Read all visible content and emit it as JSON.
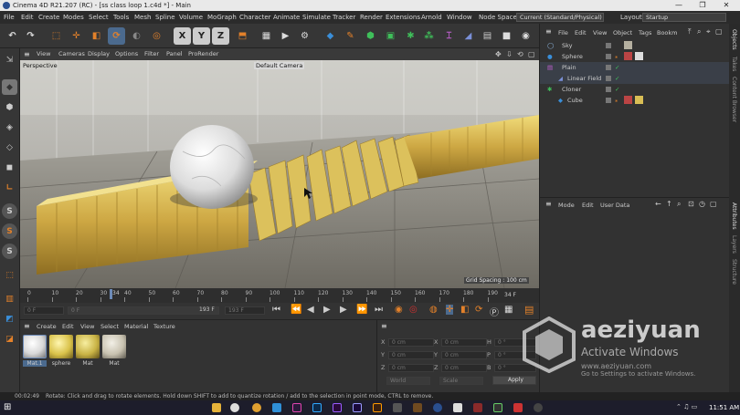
{
  "window": {
    "title": "Cinema 4D R21.207 (RC) - [ss class loop 1.c4d *] - Main",
    "minimize": "—",
    "maximize": "❐",
    "close": "✕"
  },
  "menubar": {
    "items": [
      "File",
      "Edit",
      "Create",
      "Modes",
      "Select",
      "Tools",
      "Mesh",
      "Spline",
      "Volume",
      "MoGraph",
      "Character",
      "Animate",
      "Simulate",
      "Tracker",
      "Render",
      "Extensions",
      "Arnold",
      "Window"
    ],
    "node_space_label": "Node Space:",
    "node_space_value": "Current (Standard/Physical)",
    "layout_label": "Layout:",
    "layout_value": "Startup"
  },
  "toolbar": {
    "axis_x": "X",
    "axis_y": "Y",
    "axis_z": "Z"
  },
  "left_tools": {
    "s1": "S",
    "s2": "S",
    "s3": "S"
  },
  "viewport": {
    "menu": [
      "View",
      "Cameras",
      "Display",
      "Options",
      "Filter",
      "Panel",
      "ProRender"
    ],
    "mode_label": "Perspective",
    "camera_label": "Default Camera",
    "grid_spacing": "Grid Spacing : 100 cm"
  },
  "timeline": {
    "ticks": [
      "0",
      "10",
      "20",
      "30",
      "40",
      "50",
      "60",
      "70",
      "80",
      "90",
      "100",
      "110",
      "120",
      "130",
      "140",
      "150",
      "160",
      "170",
      "180",
      "190"
    ],
    "current_frame": "34",
    "end_frame": "34 F"
  },
  "transport": {
    "start_field": "0 F",
    "current_field": "0 F",
    "max_field": "193 F",
    "end_field": "193 F"
  },
  "material_manager": {
    "menu": [
      "Create",
      "Edit",
      "View",
      "Select",
      "Material",
      "Texture"
    ],
    "materials": [
      {
        "name": "Mat.1",
        "color": "#d8d8d8"
      },
      {
        "name": "sphere",
        "color": "#d9c24a"
      },
      {
        "name": "Mat",
        "color": "#c9b345"
      },
      {
        "name": "Mat",
        "color": "#c8c2b0"
      }
    ]
  },
  "coordinates": {
    "x_label": "X",
    "y_label": "Y",
    "z_label": "Z",
    "x_val": "0 cm",
    "y_val": "0 cm",
    "z_val": "0 cm",
    "sx_val": "0 cm",
    "sy_val": "0 cm",
    "sz_val": "0 cm",
    "h_label": "H",
    "p_label": "P",
    "b_label": "B",
    "h_val": "0 °",
    "p_val": "0 °",
    "b_val": "0 °",
    "world_select": "World",
    "scale_select": "Scale",
    "apply_label": "Apply"
  },
  "object_manager": {
    "menu": [
      "File",
      "Edit",
      "View",
      "Object",
      "Tags",
      "Bookm"
    ],
    "objects": [
      {
        "name": "Sky",
        "indent": 0
      },
      {
        "name": "Sphere",
        "indent": 0
      },
      {
        "name": "Plain",
        "indent": 0
      },
      {
        "name": "Linear Field",
        "indent": 1
      },
      {
        "name": "Cloner",
        "indent": 0
      },
      {
        "name": "Cube",
        "indent": 1
      }
    ]
  },
  "attribute_manager": {
    "menu": [
      "Mode",
      "Edit",
      "User Data"
    ]
  },
  "side_tabs": [
    "Objects",
    "Takes",
    "Content Browser",
    "Attributes",
    "Layers",
    "Structure"
  ],
  "status": {
    "time": "00:02:49",
    "message": "Rotate: Click and drag to rotate elements. Hold down SHIFT to add to quantize rotation / add to the selection in point mode, CTRL to remove."
  },
  "watermark": {
    "brand": "aeziyuan",
    "sub": "www.aeziyuan.com",
    "activate_title": "Activate Windows",
    "activate_sub": "Go to Settings to activate Windows."
  },
  "taskbar": {
    "clock": "11:51 AM"
  },
  "colors": {
    "accent_orange": "#e3812a",
    "cube_blue": "#3a8ed8",
    "gold": "#d9be55"
  }
}
